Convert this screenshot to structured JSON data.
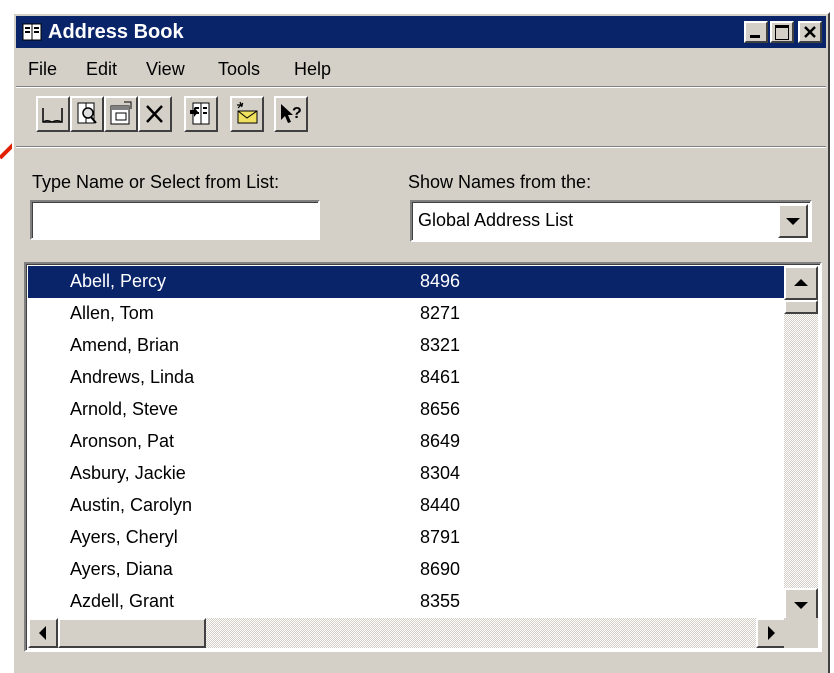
{
  "window": {
    "title": "Address Book"
  },
  "menu": [
    "File",
    "Edit",
    "View",
    "Tools",
    "Help"
  ],
  "toolbar": {
    "buttons": [
      {
        "name": "new-entry-icon"
      },
      {
        "name": "find-items-icon"
      },
      {
        "name": "properties-icon"
      },
      {
        "name": "delete-icon"
      },
      {
        "name": "add-to-personal-address-book-icon"
      },
      {
        "name": "new-message-icon"
      },
      {
        "name": "help-icon"
      }
    ]
  },
  "search": {
    "label": "Type Name or Select from List:",
    "value": ""
  },
  "source": {
    "label": "Show Names from the:",
    "value": "Global Address List"
  },
  "list": {
    "rows": [
      {
        "name": "Abell, Percy",
        "ext": "8496",
        "selected": true
      },
      {
        "name": "Allen, Tom",
        "ext": "8271"
      },
      {
        "name": "Amend, Brian",
        "ext": "8321"
      },
      {
        "name": "Andrews, Linda",
        "ext": "8461"
      },
      {
        "name": "Arnold, Steve",
        "ext": "8656"
      },
      {
        "name": "Aronson, Pat",
        "ext": "8649"
      },
      {
        "name": "Asbury, Jackie",
        "ext": "8304"
      },
      {
        "name": "Austin, Carolyn",
        "ext": "8440"
      },
      {
        "name": "Ayers, Cheryl",
        "ext": "8791"
      },
      {
        "name": "Ayers, Diana",
        "ext": "8690"
      },
      {
        "name": "Azdell, Grant",
        "ext": "8355"
      }
    ]
  },
  "colors": {
    "titlebar": "#0a246a",
    "face": "#d4d0c8",
    "selection": "#0a246a",
    "pointer": "#e02000"
  }
}
